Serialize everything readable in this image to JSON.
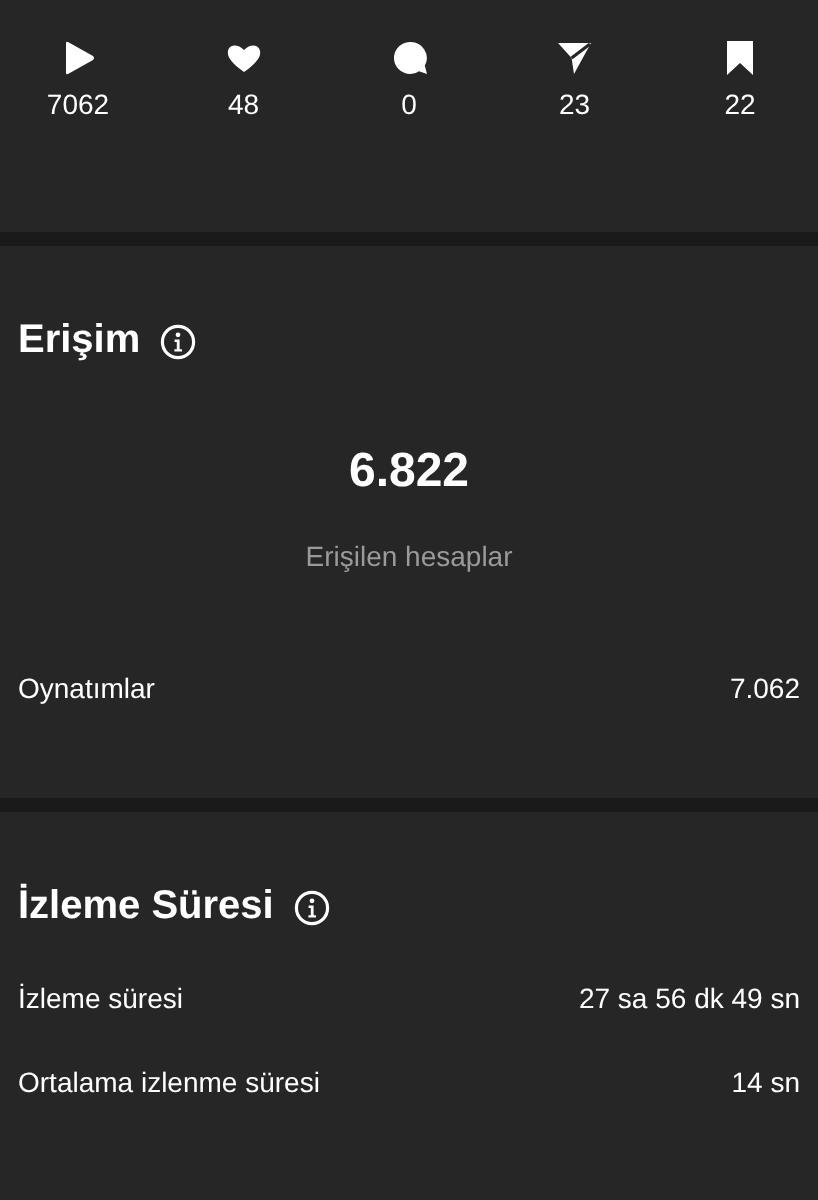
{
  "stats": [
    {
      "kind": "play",
      "value": "7062"
    },
    {
      "kind": "like",
      "value": "48"
    },
    {
      "kind": "comment",
      "value": "0"
    },
    {
      "kind": "share",
      "value": "23"
    },
    {
      "kind": "save",
      "value": "22"
    }
  ],
  "reach": {
    "title": "Erişim",
    "big_number": "6.822",
    "big_label": "Erişilen hesaplar",
    "rows": [
      {
        "label": "Oynatımlar",
        "value": "7.062"
      }
    ]
  },
  "watch_time": {
    "title": "İzleme Süresi",
    "rows": [
      {
        "label": "İzleme süresi",
        "value": "27 sa 56 dk 49 sn"
      },
      {
        "label": "Ortalama izlenme süresi",
        "value": "14 sn"
      }
    ]
  }
}
